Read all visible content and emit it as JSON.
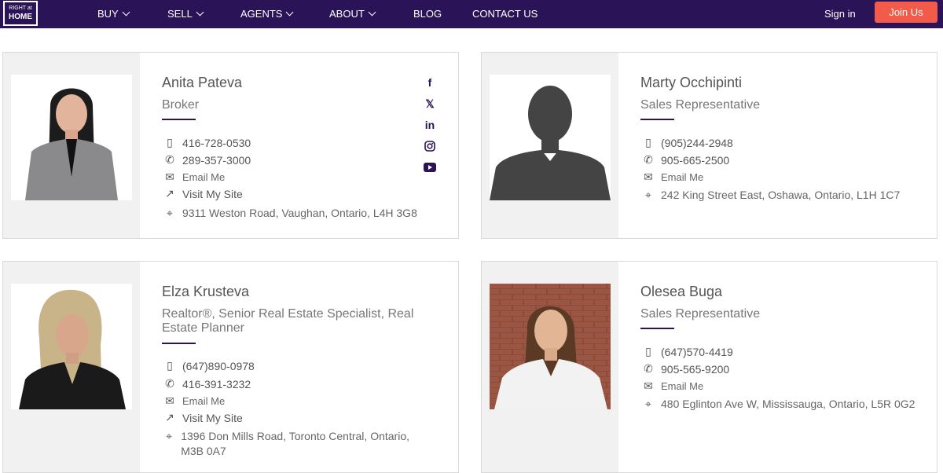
{
  "nav": {
    "logo_top": "RIGHT at",
    "logo_main": "HOME",
    "items": [
      "BUY",
      "SELL",
      "AGENTS",
      "ABOUT",
      "BLOG",
      "CONTACT US"
    ],
    "signin": "Sign in",
    "join": "Join Us",
    "colors": {
      "bar": "#2a1357",
      "join": "#f25a4a"
    }
  },
  "agents": [
    {
      "name": "Anita Pateva",
      "title": "Broker",
      "mobile": "416-728-0530",
      "phone": "289-357-3000",
      "email": "Email Me",
      "site": "Visit My Site",
      "address": "9311 Weston Road, Vaughan, Ontario, L4H 3G8",
      "social": [
        "facebook-icon",
        "x-icon",
        "linkedin-icon",
        "instagram-icon",
        "youtube-icon"
      ]
    },
    {
      "name": "Marty Occhipinti",
      "title": "Sales Representative",
      "mobile": "(905)244-2948",
      "phone": "905-665-2500",
      "email": "Email Me",
      "address": "242 King Street East, Oshawa, Ontario, L1H 1C7"
    },
    {
      "name": "Elza Krusteva",
      "title": "Realtor®, Senior Real Estate Specialist, Real Estate Planner",
      "mobile": "(647)890-0978",
      "phone": "416-391-3232",
      "email": "Email Me",
      "site": "Visit My Site",
      "address": "1396 Don Mills Road, Toronto Central, Ontario, M3B 0A7"
    },
    {
      "name": "Olesea Buga",
      "title": "Sales Representative",
      "mobile": "(647)570-4419",
      "phone": "905-565-9200",
      "email": "Email Me",
      "address": "480 Eglinton Ave W, Mississauga, Ontario, L5R 0G2"
    }
  ]
}
